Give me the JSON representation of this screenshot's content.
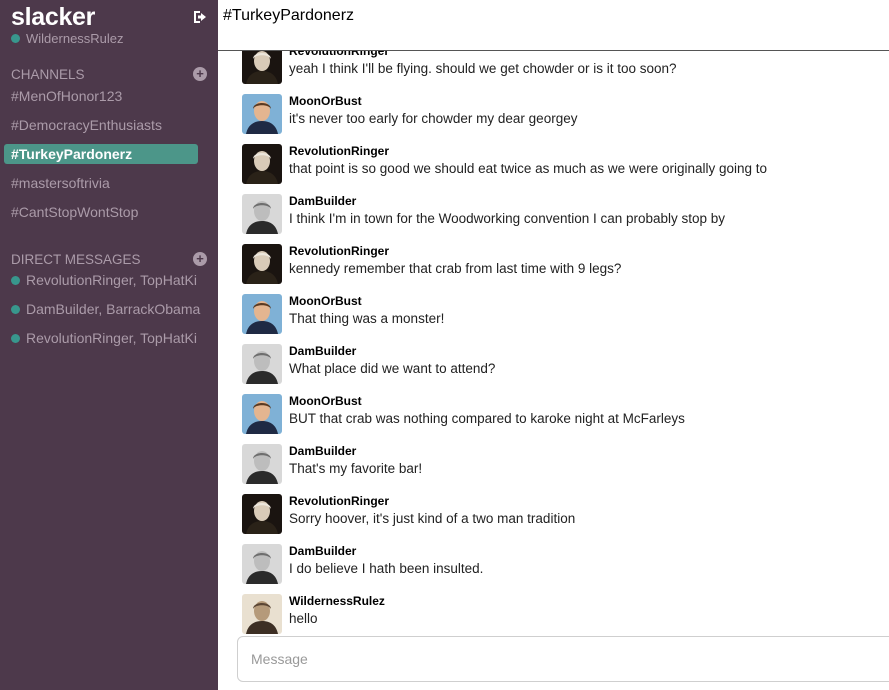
{
  "app": {
    "brand": "slacker"
  },
  "user": {
    "name": "WildernessRulez",
    "status_color": "#38978d"
  },
  "channels_section": {
    "title": "CHANNELS",
    "items": [
      {
        "label": "#MenOfHonor123",
        "active": false
      },
      {
        "label": "#DemocracyEnthusiasts",
        "active": false
      },
      {
        "label": "#TurkeyPardonerz",
        "active": true
      },
      {
        "label": "#mastersoftrivia",
        "active": false
      },
      {
        "label": "#CantStopWontStop",
        "active": false
      }
    ]
  },
  "dm_section": {
    "title": "DIRECT MESSAGES",
    "items": [
      {
        "label": "RevolutionRinger, TopHatKi"
      },
      {
        "label": "DamBuilder, BarrackObama"
      },
      {
        "label": "RevolutionRinger, TopHatKi"
      }
    ]
  },
  "header": {
    "title": "#TurkeyPardonerz"
  },
  "messages": [
    {
      "author": "RevolutionRinger",
      "avatar": "washington-portrait",
      "text": "yeah I think I'll be flying. should we get chowder or is it too soon?"
    },
    {
      "author": "MoonOrBust",
      "avatar": "kennedy-portrait",
      "text": "it's never too early for chowder my dear georgey"
    },
    {
      "author": "RevolutionRinger",
      "avatar": "washington-portrait",
      "text": "that point is so good we should eat twice as much as we were originally going to"
    },
    {
      "author": "DamBuilder",
      "avatar": "hoover-portrait",
      "text": "I think I'm in town for the Woodworking convention I can probably stop by"
    },
    {
      "author": "RevolutionRinger",
      "avatar": "washington-portrait",
      "text": "kennedy remember that crab from last time with 9 legs?"
    },
    {
      "author": "MoonOrBust",
      "avatar": "kennedy-portrait",
      "text": "That thing was a monster!"
    },
    {
      "author": "DamBuilder",
      "avatar": "hoover-portrait",
      "text": "What place did we want to attend?"
    },
    {
      "author": "MoonOrBust",
      "avatar": "kennedy-portrait",
      "text": "BUT that crab was nothing compared to karoke night at McFarleys"
    },
    {
      "author": "DamBuilder",
      "avatar": "hoover-portrait",
      "text": "That's my favorite bar!"
    },
    {
      "author": "RevolutionRinger",
      "avatar": "washington-portrait",
      "text": "Sorry hoover, it's just kind of a two man tradition"
    },
    {
      "author": "DamBuilder",
      "avatar": "hoover-portrait",
      "text": "I do believe I hath been insulted."
    },
    {
      "author": "WildernessRulez",
      "avatar": "roosevelt-portrait",
      "text": "hello"
    }
  ],
  "composer": {
    "placeholder": "Message",
    "value": ""
  }
}
